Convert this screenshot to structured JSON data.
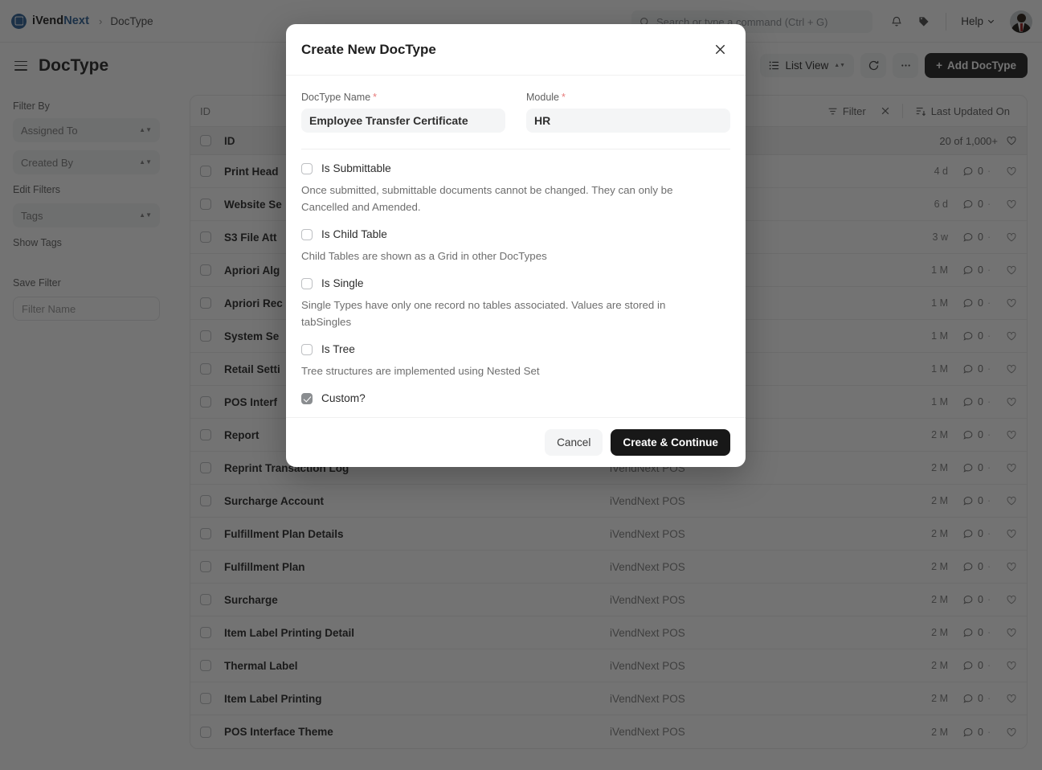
{
  "navbar": {
    "brand_prefix": "iVend",
    "brand_suffix": "Next",
    "breadcrumb_sep": "›",
    "breadcrumb": "DocType",
    "search_placeholder": "Search or type a command (Ctrl + G)",
    "help_label": "Help"
  },
  "page_header": {
    "title": "DocType",
    "list_view_label": "List View",
    "add_button_label": "Add DocType",
    "add_button_plus": "+"
  },
  "sidebar": {
    "filter_by_label": "Filter By",
    "assigned_to": "Assigned To",
    "created_by": "Created By",
    "edit_filters": "Edit Filters",
    "tags": "Tags",
    "show_tags": "Show Tags",
    "save_filter": "Save Filter",
    "filter_name_placeholder": "Filter Name"
  },
  "list_toolbar": {
    "id_label": "ID",
    "filter_label": "Filter",
    "sort_label": "Last Updated On"
  },
  "list_header": {
    "id_column": "ID",
    "count_label": "20 of 1,000+"
  },
  "rows": [
    {
      "name": "Print Head",
      "module": "",
      "time": "4 d",
      "comments": "0"
    },
    {
      "name": "Website Se",
      "module": "",
      "time": "6 d",
      "comments": "0"
    },
    {
      "name": "S3 File Att",
      "module": "",
      "time": "3 w",
      "comments": "0"
    },
    {
      "name": "Apriori Alg",
      "module": "",
      "time": "1 M",
      "comments": "0"
    },
    {
      "name": "Apriori Rec",
      "module": "",
      "time": "1 M",
      "comments": "0"
    },
    {
      "name": "System Se",
      "module": "",
      "time": "1 M",
      "comments": "0"
    },
    {
      "name": "Retail Setti",
      "module": "",
      "time": "1 M",
      "comments": "0"
    },
    {
      "name": "POS Interf",
      "module": "",
      "time": "1 M",
      "comments": "0"
    },
    {
      "name": "Report",
      "module": "",
      "time": "2 M",
      "comments": "0"
    },
    {
      "name": "Reprint Transaction Log",
      "module": "iVendNext POS",
      "time": "2 M",
      "comments": "0"
    },
    {
      "name": "Surcharge Account",
      "module": "iVendNext POS",
      "time": "2 M",
      "comments": "0"
    },
    {
      "name": "Fulfillment Plan Details",
      "module": "iVendNext POS",
      "time": "2 M",
      "comments": "0"
    },
    {
      "name": "Fulfillment Plan",
      "module": "iVendNext POS",
      "time": "2 M",
      "comments": "0"
    },
    {
      "name": "Surcharge",
      "module": "iVendNext POS",
      "time": "2 M",
      "comments": "0"
    },
    {
      "name": "Item Label Printing Detail",
      "module": "iVendNext POS",
      "time": "2 M",
      "comments": "0"
    },
    {
      "name": "Thermal Label",
      "module": "iVendNext POS",
      "time": "2 M",
      "comments": "0"
    },
    {
      "name": "Item Label Printing",
      "module": "iVendNext POS",
      "time": "2 M",
      "comments": "0"
    },
    {
      "name": "POS Interface Theme",
      "module": "iVendNext POS",
      "time": "2 M",
      "comments": "0"
    }
  ],
  "modal": {
    "title": "Create New DocType",
    "fields": {
      "doctype_name_label": "DocType Name",
      "doctype_name_value": "Employee Transfer Certificate",
      "module_label": "Module",
      "module_value": "HR",
      "required_mark": "*"
    },
    "checks": [
      {
        "label": "Is Submittable",
        "checked": false,
        "description": "Once submitted, submittable documents cannot be changed. They can only be Cancelled and Amended."
      },
      {
        "label": "Is Child Table",
        "checked": false,
        "description": "Child Tables are shown as a Grid in other DocTypes"
      },
      {
        "label": "Is Single",
        "checked": false,
        "description": "Single Types have only one record no tables associated. Values are stored in tabSingles"
      },
      {
        "label": "Is Tree",
        "checked": false,
        "description": "Tree structures are implemented using Nested Set"
      },
      {
        "label": "Custom?",
        "checked": true,
        "description": ""
      }
    ],
    "cancel_label": "Cancel",
    "submit_label": "Create & Continue"
  },
  "colors": {
    "accent": "#3f6d9e",
    "primary_button": "#181818",
    "required": "#e77a7a",
    "field_bg": "#f4f5f6"
  }
}
